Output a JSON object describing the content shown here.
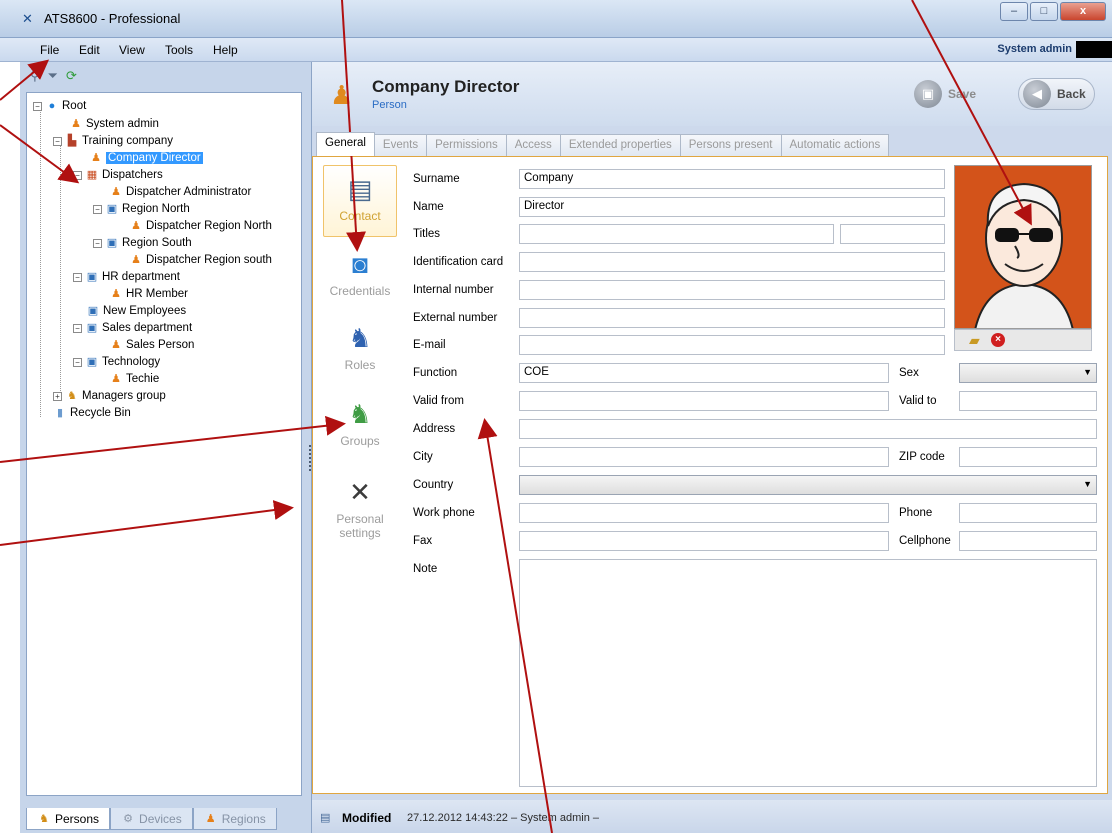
{
  "window": {
    "title": "ATS8600 - Professional",
    "icon": "app-icon",
    "min": "–",
    "max": "□",
    "close": "x"
  },
  "menu": {
    "items": [
      "File",
      "Edit",
      "View",
      "Tools",
      "Help"
    ],
    "user": "System admin"
  },
  "tree": {
    "items": [
      {
        "label": "Root",
        "icon": "globe"
      },
      {
        "label": "System admin",
        "icon": "person"
      },
      {
        "label": "Training company",
        "icon": "company"
      },
      {
        "label": "Company Director",
        "icon": "person"
      },
      {
        "label": "Dispatchers",
        "icon": "dispatcher-group"
      },
      {
        "label": "Dispatcher Administrator",
        "icon": "person"
      },
      {
        "label": "Region North",
        "icon": "department"
      },
      {
        "label": "Dispatcher Region North",
        "icon": "person"
      },
      {
        "label": "Region South",
        "icon": "department"
      },
      {
        "label": "Dispatcher Region south",
        "icon": "person"
      },
      {
        "label": "HR department",
        "icon": "department"
      },
      {
        "label": "HR Member",
        "icon": "person"
      },
      {
        "label": "New Employees",
        "icon": "department"
      },
      {
        "label": "Sales department",
        "icon": "department"
      },
      {
        "label": "Sales Person",
        "icon": "person"
      },
      {
        "label": "Technology",
        "icon": "department"
      },
      {
        "label": "Techie",
        "icon": "person"
      },
      {
        "label": "Managers group",
        "icon": "group"
      },
      {
        "label": "Recycle Bin",
        "icon": "bin"
      }
    ]
  },
  "left_tabs": [
    "Persons",
    "Devices",
    "Regions"
  ],
  "header": {
    "title": "Company Director",
    "subtitle": "Person",
    "save_label": "Save",
    "back_label": "Back"
  },
  "tabs": [
    "General",
    "Events",
    "Permissions",
    "Access",
    "Extended properties",
    "Persons present",
    "Automatic actions"
  ],
  "sidenav": [
    "Contact",
    "Credentials",
    "Roles",
    "Groups",
    "Personal settings"
  ],
  "form": {
    "surname_label": "Surname",
    "surname_value": "Company",
    "name_label": "Name",
    "name_value": "Director",
    "titles_label": "Titles",
    "idcard_label": "Identification card",
    "internal_label": "Internal number",
    "external_label": "External number",
    "email_label": "E-mail",
    "function_label": "Function",
    "function_value": "COE",
    "sex_label": "Sex",
    "validfrom_label": "Valid from",
    "validto_label": "Valid to",
    "address_label": "Address",
    "city_label": "City",
    "zip_label": "ZIP code",
    "country_label": "Country",
    "workphone_label": "Work phone",
    "phone_label": "Phone",
    "fax_label": "Fax",
    "cellphone_label": "Cellphone",
    "note_label": "Note"
  },
  "status": {
    "modified_label": "Modified",
    "text": "27.12.2012 14:43:22 – System admin –"
  },
  "colors": {
    "annotation_arrow": "#b01010",
    "selection": "#3399ff",
    "accent": "#e0a640",
    "photo_bg": "#d3531a"
  }
}
